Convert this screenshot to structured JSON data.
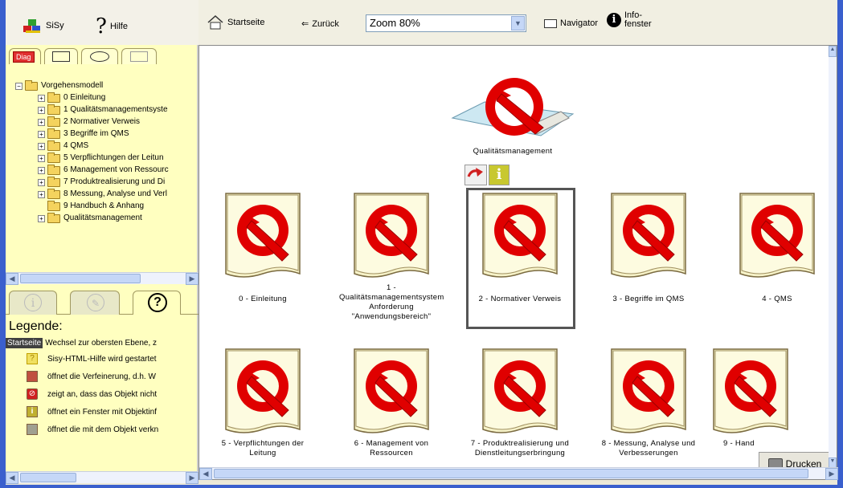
{
  "app": {
    "sisy_label": "SiSy",
    "help_label": "Hilfe"
  },
  "toolbar": {
    "home_label": "Startseite",
    "back_label": "Zurück",
    "zoom_value": "Zoom 80%",
    "navigator_label": "Navigator",
    "info_label_line1": "Info-",
    "info_label_line2": "fenster"
  },
  "left_tabs": {
    "active": "Diag"
  },
  "tree": {
    "root": "Vorgehensmodell",
    "items": [
      "0 Einleitung",
      "1 Qualitätsmanagementsyste",
      "2 Normativer Verweis",
      "3 Begriffe im QMS",
      "4 QMS",
      "5 Verpflichtungen der Leitun",
      "6 Management von Ressourc",
      "7 Produktrealisierung und Di",
      "8 Messung, Analyse und Verl",
      "9 Handbuch & Anhang",
      "Qualitätsmanagement"
    ]
  },
  "lower_tabs": {
    "help_icon": "?"
  },
  "legend": {
    "title": "Legende:",
    "startseite_tag": "Startseite",
    "rows": [
      "Wechsel zur obersten Ebene, z",
      "Sisy-HTML-Hilfe wird gestartet",
      "öffnet die Verfeinerung, d.h. W",
      "zeigt an, dass das Objekt nicht",
      "öffnet ein Fenster mit Objektinf",
      "öffnet die mit dem Objekt verkn"
    ]
  },
  "diagram": {
    "top_label": "Qualitätsmanagement",
    "row1": [
      "0 - Einleitung",
      "1 - Qualitätsmanagementsystem Anforderung \"Anwendungsbereich\"",
      "2 - Normativer Verweis",
      "3 - Begriffe im QMS",
      "4 - QMS"
    ],
    "row2": [
      "5 - Verpflichtungen der Leitung",
      "6 - Management von Ressourcen",
      "7 - Produktrealisierung und Dienstleitungserbringung",
      "8 - Messung, Analyse und Verbesserungen",
      "9 - Hand"
    ]
  },
  "print_label": "Drucken",
  "colors": {
    "brand_blue": "#3a5fcd",
    "panel_yellow": "#ffffc0",
    "q_red": "#e00000"
  }
}
